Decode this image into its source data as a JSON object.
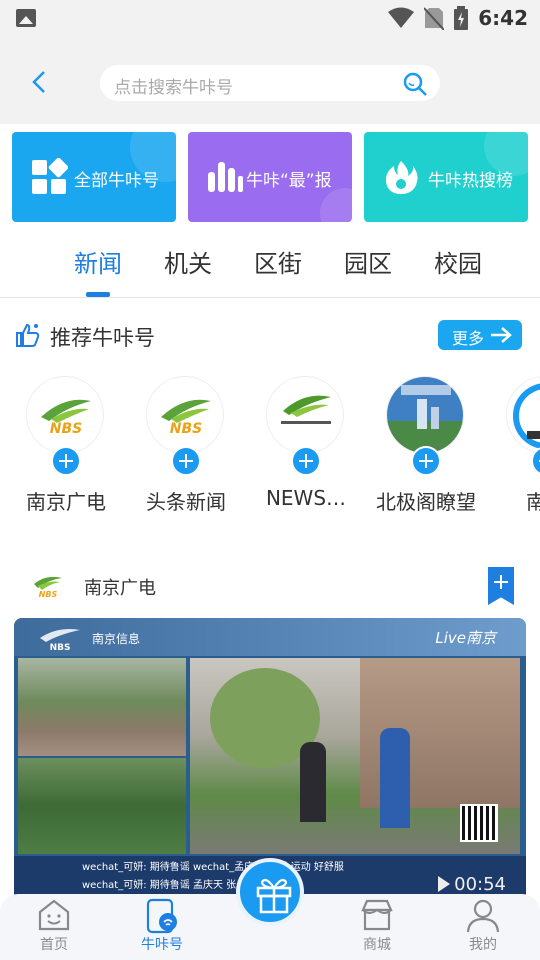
{
  "status_bar": {
    "time": "6:42"
  },
  "search": {
    "placeholder": "点击搜索牛咔号"
  },
  "feature_cards": [
    {
      "label": "全部牛咔号",
      "icon": "grid-icon",
      "color": "#1aa7ef"
    },
    {
      "label": "牛咔“最”报",
      "icon": "bar-chart-icon",
      "color": "#9a6cf0"
    },
    {
      "label": "牛咔热搜榜",
      "icon": "flame-icon",
      "color": "#1fd0cf"
    }
  ],
  "tabs": [
    "新闻",
    "机关",
    "区街",
    "园区",
    "校园"
  ],
  "active_tab": "新闻",
  "recommend": {
    "title": "推荐牛咔号",
    "more": "更多"
  },
  "accounts": [
    {
      "name": "南京广电",
      "logo": "NBS"
    },
    {
      "name": "头条新闻",
      "logo": "NBS"
    },
    {
      "name": "NEWS…",
      "logo": "南京新闻综合频道"
    },
    {
      "name": "北极阁瞭望",
      "logo": "北极阁"
    },
    {
      "name": "南京",
      "logo": ""
    }
  ],
  "feed": {
    "source": "南京广电",
    "video": {
      "live_label": "Live南京",
      "brand_label": "南京信息",
      "ticker_lines": [
        "wechat_可妍:  期待鲁谣          wechat_孟庆天:  这个运动  好舒服",
        "wechat_可妍:  期待鲁谣          孟庆天    张总  就是帅啊"
      ],
      "duration": "00:54"
    }
  },
  "bottom_nav": [
    {
      "label": "首页",
      "icon": "home-face-icon",
      "active": false
    },
    {
      "label": "牛咔号",
      "icon": "niuka-icon",
      "active": true
    },
    {
      "label": "",
      "icon": "gift-icon",
      "active": false
    },
    {
      "label": "商城",
      "icon": "shop-icon",
      "active": false
    },
    {
      "label": "我的",
      "icon": "user-icon",
      "active": false
    }
  ],
  "colors": {
    "accent": "#1f7fe0",
    "blue": "#1aa7ef",
    "purple": "#9a6cf0",
    "teal": "#1fd0cf"
  }
}
